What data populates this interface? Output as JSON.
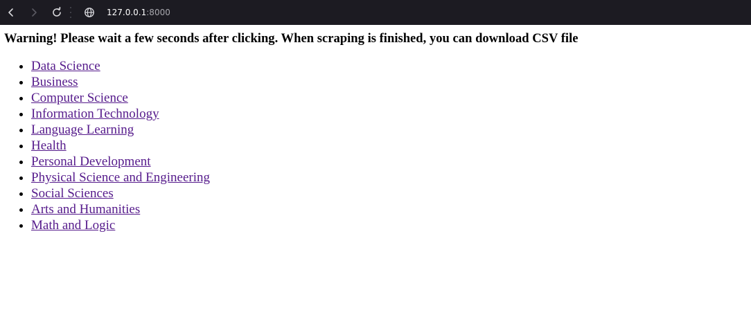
{
  "browser": {
    "url_host": "127.0.0.1",
    "url_port": ":8000",
    "icons": {
      "back": "chevron-left-icon",
      "forward": "chevron-right-icon",
      "reload": "reload-icon",
      "site_info": "globe-icon"
    },
    "colors": {
      "toolbar_bg": "#1c1b22",
      "url_host": "#ffffff",
      "url_port": "#a8a8ae"
    }
  },
  "page": {
    "warning": "Warning! Please wait a few seconds after clicking. When scraping is finished, you can download CSV file",
    "link_color": "#551a8b",
    "categories": [
      "Data Science",
      "Business",
      "Computer Science",
      "Information Technology",
      "Language Learning",
      "Health",
      "Personal Development",
      "Physical Science and Engineering",
      "Social Sciences",
      "Arts and Humanities",
      "Math and Logic"
    ]
  }
}
